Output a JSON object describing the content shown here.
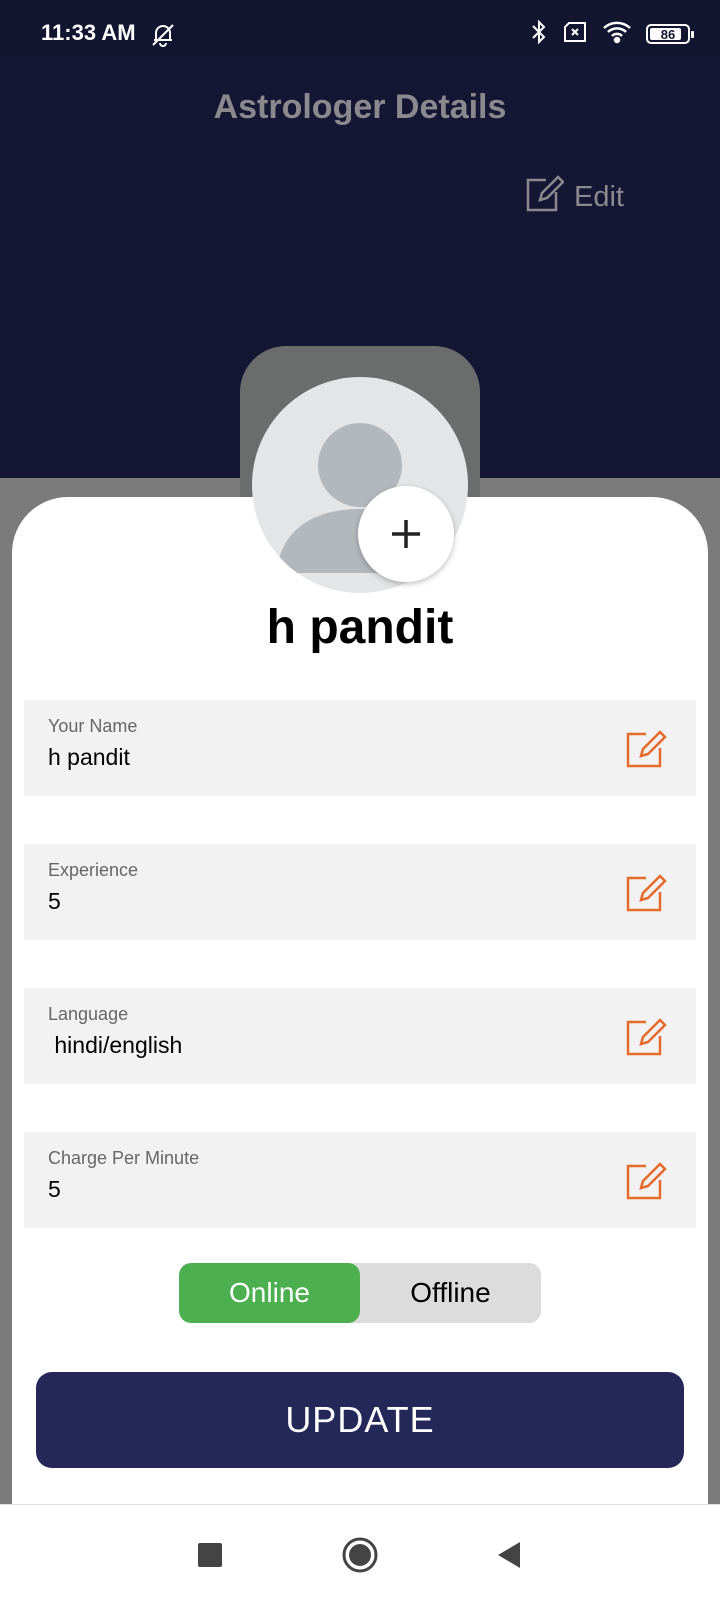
{
  "status_bar": {
    "time": "11:33 AM",
    "battery": "86",
    "battery_level": 0.86,
    "icons": [
      "bell-off-icon",
      "bluetooth-icon",
      "sim-off-icon",
      "wifi-icon",
      "battery-icon"
    ]
  },
  "header": {
    "title": "Astrologer Details",
    "edit_label": "Edit"
  },
  "profile": {
    "name": "h pandit"
  },
  "fields": [
    {
      "label": "Your Name",
      "value": "h pandit"
    },
    {
      "label": "Experience",
      "value": "5"
    },
    {
      "label": "Language",
      "value": " hindi/english"
    },
    {
      "label": "Charge Per Minute",
      "value": "5"
    }
  ],
  "status_toggle": {
    "online": "Online",
    "offline": "Offline",
    "selected": "Online"
  },
  "update_label": "UPDATE",
  "colors": {
    "header_bg": "#141634",
    "accent_orange": "#e86a2b",
    "online_green": "#4caf50",
    "button_navy": "#232859"
  }
}
